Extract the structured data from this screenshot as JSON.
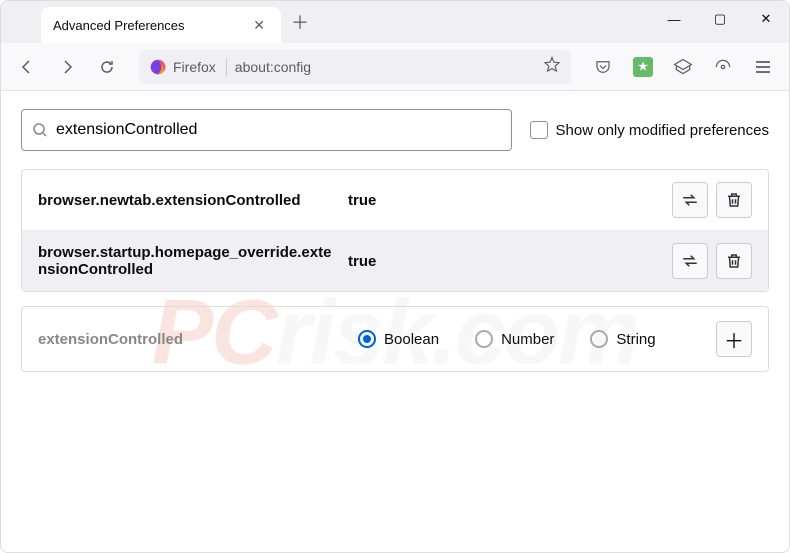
{
  "window": {
    "tab_title": "Advanced Preferences"
  },
  "toolbar": {
    "identity_label": "Firefox",
    "url": "about:config"
  },
  "search": {
    "value": "extensionControlled",
    "checkbox_label": "Show only modified preferences"
  },
  "prefs": [
    {
      "name": "browser.newtab.extensionControlled",
      "value": "true"
    },
    {
      "name": "browser.startup.homepage_override.extensionControlled",
      "value": "true"
    }
  ],
  "new_pref": {
    "name": "extensionControlled",
    "types": [
      "Boolean",
      "Number",
      "String"
    ],
    "selected": "Boolean"
  },
  "watermark": {
    "left": "PC",
    "right": "risk.com"
  }
}
